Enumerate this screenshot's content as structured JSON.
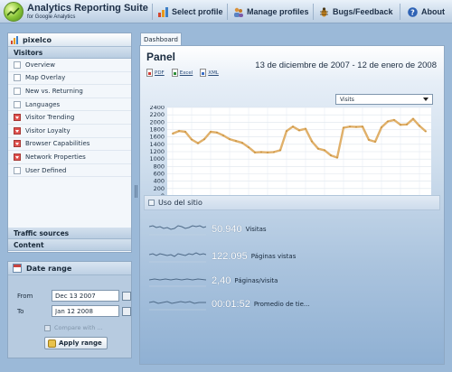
{
  "header": {
    "brand_title": "Analytics Reporting Suite",
    "brand_subtitle": "for Google Analytics",
    "nav": [
      {
        "label": "Select profile",
        "icon": "chart-icon"
      },
      {
        "label": "Manage profiles",
        "icon": "users-icon"
      },
      {
        "label": "Bugs/Feedback",
        "icon": "bug-icon"
      },
      {
        "label": "About",
        "icon": "help-icon"
      }
    ]
  },
  "sidebar": {
    "profile": "pixelco",
    "section_visitors": "Visitors",
    "items": [
      {
        "label": "Overview",
        "expandable": false
      },
      {
        "label": "Map Overlay",
        "expandable": false
      },
      {
        "label": "New vs. Returning",
        "expandable": false
      },
      {
        "label": "Languages",
        "expandable": false
      },
      {
        "label": "Visitor Trending",
        "expandable": true
      },
      {
        "label": "Visitor Loyalty",
        "expandable": true
      },
      {
        "label": "Browser Capabilities",
        "expandable": true
      },
      {
        "label": "Network Properties",
        "expandable": true
      },
      {
        "label": "User Defined",
        "expandable": false
      }
    ],
    "section_traffic": "Traffic sources",
    "section_content": "Content"
  },
  "date_range": {
    "title": "Date range",
    "from_label": "From",
    "from_value": "Dec 13 2007",
    "to_label": "To",
    "to_value": "Jan 12 2008",
    "compare_label": "Compare with ...",
    "apply_label": "Apply range"
  },
  "main": {
    "tab": "Dashboard",
    "title": "Panel",
    "date_range_text": "13 de diciembre de 2007 - 12 de enero de 2008",
    "exports": [
      {
        "label": "PDF",
        "icon": "pdf-icon"
      },
      {
        "label": "Excel",
        "icon": "excel-icon"
      },
      {
        "label": "XML",
        "icon": "xml-icon"
      }
    ],
    "metric_select": "Visits",
    "site_usage_title": "Uso del sitio",
    "metrics": [
      {
        "value": "50.940",
        "label": "Visitas"
      },
      {
        "value": "122.095",
        "label": "Páginas vistas"
      },
      {
        "value": "2,40",
        "label": "Páginas/visita"
      },
      {
        "value": "00:01:52",
        "label": "Promedio de tie..."
      }
    ]
  },
  "colors": {
    "line": "#e0b06a",
    "background": "#9bb9d8",
    "accent_red": "#e0524f"
  },
  "chart_data": {
    "type": "line",
    "ylim": [
      0,
      2400
    ],
    "yticks": [
      "2400",
      "2200",
      "2000",
      "1800",
      "1600",
      "1400",
      "1200",
      "1000",
      "800",
      "600",
      "400",
      "200",
      "0"
    ],
    "grid": true,
    "series": [
      {
        "values": [
          1690,
          1760,
          1740,
          1530,
          1430,
          1540,
          1740,
          1720,
          1640,
          1540,
          1490,
          1440,
          1320,
          1180,
          1190,
          1180,
          1190,
          1240,
          1760,
          1880,
          1780,
          1820,
          1480,
          1280,
          1240,
          1100,
          1040,
          1850,
          1880,
          1870,
          1880,
          1520,
          1470,
          1860,
          2020,
          2060,
          1930,
          1940,
          2090,
          1900,
          1750
        ]
      }
    ]
  }
}
